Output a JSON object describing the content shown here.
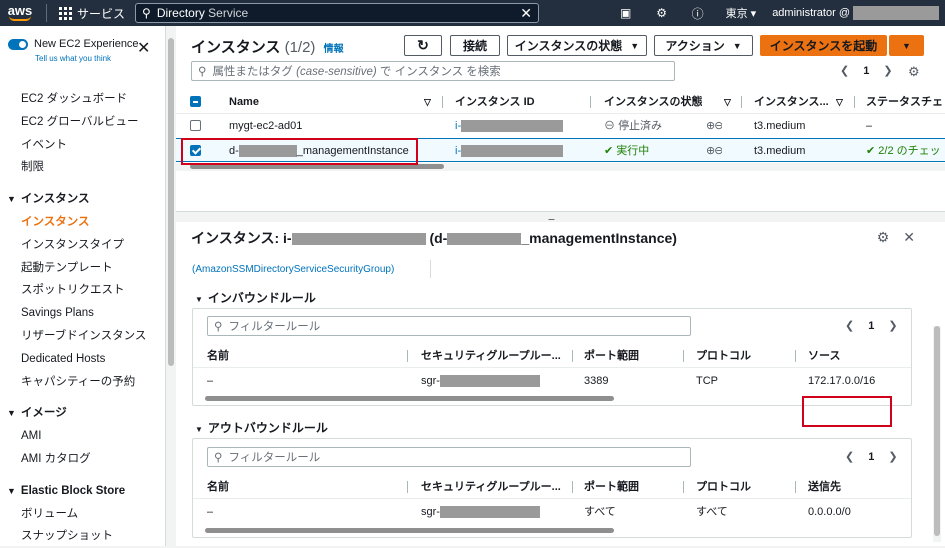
{
  "topbar": {
    "logo": "aws",
    "services": "サービス",
    "search_bold": "Directory",
    "search_rest": "Service",
    "region": "東京 ▾",
    "account": "administrator @"
  },
  "sidebar": {
    "experience": "New EC2 Experience",
    "tell": "Tell us what you think",
    "items": [
      "EC2 ダッシュボード",
      "EC2 グローバルビュー",
      "イベント",
      "制限"
    ],
    "group1": "インスタンス",
    "group1_items": [
      "インスタンス",
      "インスタンスタイプ",
      "起動テンプレート",
      "スポットリクエスト",
      "Savings Plans",
      "リザーブドインスタンス",
      "Dedicated Hosts",
      "キャパシティーの予約"
    ],
    "group2": "イメージ",
    "group2_items": [
      "AMI",
      "AMI カタログ"
    ],
    "group3": "Elastic Block Store",
    "group3_items": [
      "ボリューム",
      "スナップショット"
    ]
  },
  "instances": {
    "title": "インスタンス",
    "count": "(1/2)",
    "info": "情報",
    "btn_connect": "接続",
    "btn_state": "インスタンスの状態",
    "btn_actions": "アクション",
    "btn_launch": "インスタンスを起動",
    "filter_placeholder": "属性またはタグ",
    "filter_case": "(case-sensitive)",
    "filter_rest": "で インスタンス を検索",
    "page": "1",
    "columns": [
      "Name",
      "インスタンス ID",
      "インスタンスの状態",
      "インスタンス...",
      "ステータスチェ"
    ],
    "rows": [
      {
        "name": "mygt-ec2-ad01",
        "id_prefix": "i-",
        "state": "停止済み",
        "type": "t3.medium",
        "status": "–"
      },
      {
        "name_prefix": "d-",
        "name_suffix": "_managementInstance",
        "id_prefix": "i-",
        "state": "実行中",
        "type": "t3.medium",
        "status": "2/2 のチェッ"
      }
    ]
  },
  "detail": {
    "title_prefix": "インスタンス: i-",
    "title_mid": "(d-",
    "title_suffix": "_managementInstance)",
    "sg_link": "(AmazonSSMDirectoryServiceSecurityGroup)",
    "inbound": {
      "heading": "インバウンドルール",
      "filter": "フィルタールール",
      "page": "1",
      "columns": [
        "名前",
        "セキュリティグループルー...",
        "ポート範囲",
        "プロトコル",
        "ソース"
      ],
      "row": {
        "name": "–",
        "rule_prefix": "sgr-",
        "port": "3389",
        "protocol": "TCP",
        "source": "172.17.0.0/16"
      }
    },
    "outbound": {
      "heading": "アウトバウンドルール",
      "filter": "フィルタールール",
      "page": "1",
      "columns": [
        "名前",
        "セキュリティグループルー...",
        "ポート範囲",
        "プロトコル",
        "送信先"
      ],
      "row": {
        "name": "–",
        "rule_prefix": "sgr-",
        "port": "すべて",
        "protocol": "すべて",
        "dest": "0.0.0.0/0"
      }
    }
  }
}
